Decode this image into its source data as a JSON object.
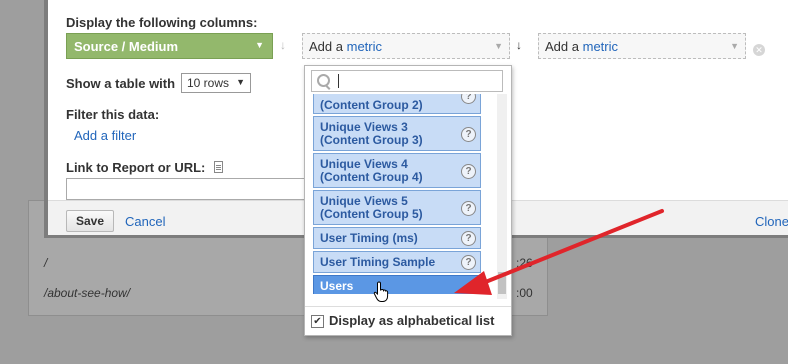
{
  "background": {
    "rows": [
      {
        "path": "/",
        "value": ":26"
      },
      {
        "path": "/about-see-how/",
        "value": ":00"
      }
    ]
  },
  "dialog": {
    "columns_label": "Display the following columns:",
    "dimension": {
      "label": "Source / Medium"
    },
    "metric1": {
      "prefix": "Add a",
      "word": "metric"
    },
    "metric2": {
      "prefix": "Add a",
      "word": "metric"
    },
    "table_label": "Show a table with",
    "rows_select": "10 rows",
    "filter_label": "Filter this data:",
    "add_filter": "Add a filter",
    "link_label": "Link to Report or URL:",
    "link_value": "",
    "save": "Save",
    "cancel": "Cancel",
    "clone": "Clone"
  },
  "dropdown": {
    "search_value": "",
    "items": [
      {
        "line1": "(Content Group 2)",
        "line2": ""
      },
      {
        "line1": "Unique Views 3",
        "line2": "(Content Group 3)"
      },
      {
        "line1": "Unique Views 4",
        "line2": "(Content Group 4)"
      },
      {
        "line1": "Unique Views 5",
        "line2": "(Content Group 5)"
      },
      {
        "line1": "User Timing (ms)",
        "line2": ""
      },
      {
        "line1": "User Timing Sample",
        "line2": ""
      },
      {
        "line1": "Users",
        "line2": ""
      }
    ],
    "help_glyph": "?",
    "alphabetical_label": "Display as alphabetical list",
    "alphabetical_checked": true
  },
  "annotation": {
    "arrow_color": "#e0252b"
  }
}
